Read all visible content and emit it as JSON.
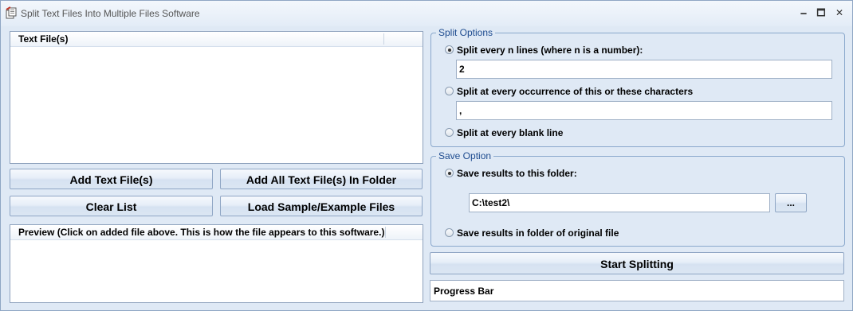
{
  "window": {
    "title": "Split Text Files Into Multiple Files Software",
    "minimize": "🗕",
    "maximize": "🗖",
    "close": "✕"
  },
  "files_list": {
    "header": "Text File(s)"
  },
  "buttons": {
    "add_files": "Add Text File(s)",
    "add_folder": "Add All Text File(s) In Folder",
    "clear_list": "Clear List",
    "load_sample": "Load Sample/Example Files",
    "browse": "...",
    "start": "Start Splitting"
  },
  "preview": {
    "header": "Preview (Click on added file above. This is how the file appears to this software.)"
  },
  "split_options": {
    "legend": "Split Options",
    "every_n_lines": {
      "label": "Split every n lines (where n is a number):",
      "selected": true,
      "value": "2"
    },
    "every_occurrence": {
      "label": "Split at every occurrence of this or these characters",
      "selected": false,
      "value": ","
    },
    "blank_line": {
      "label": "Split at every blank line",
      "selected": false
    }
  },
  "save_option": {
    "legend": "Save Option",
    "to_folder": {
      "label": "Save results to this folder:",
      "selected": true,
      "value": "C:\\test2\\"
    },
    "original_folder": {
      "label": "Save results in folder of original file",
      "selected": false
    }
  },
  "progress": {
    "label": "Progress Bar"
  }
}
